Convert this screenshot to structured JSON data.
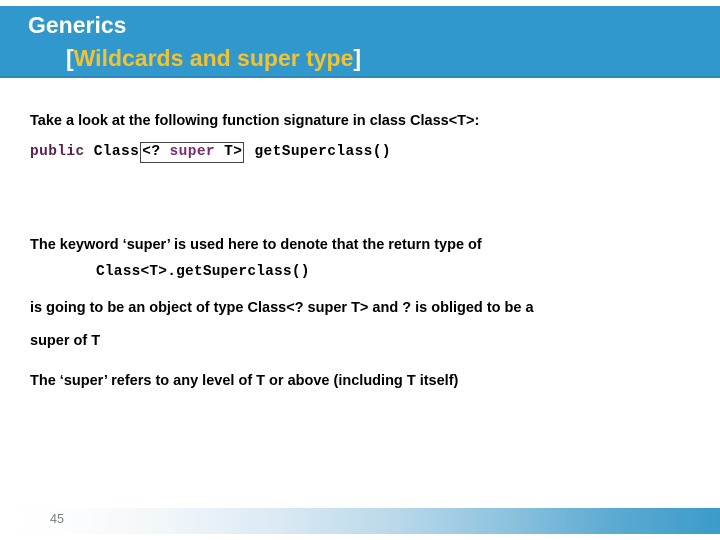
{
  "slide": {
    "banner": {
      "title": "Generics",
      "subtitle_open_bracket": "[",
      "subtitle_inner": "Wildcards and super type",
      "subtitle_close_bracket": "]",
      "background_color": "#3098cc",
      "title_color": "#ffffff",
      "subtitle_color": "#f2c230"
    },
    "body": {
      "intro_text": "Take a look at the following function signature in class Class<T>:",
      "code_signature": {
        "keyword_public": "public",
        "class_token": " Class",
        "boxed_open": "<?",
        "boxed_keyword": "super",
        "boxed_close": "T>",
        "method": " getSuperclass()",
        "keyword_color": "#5c2050",
        "box_border_color": "#444444"
      },
      "keyword_paragraph": "The keyword ‘super’ is used here to denote that the return type of",
      "code_call": "Class<T>.getSuperclass()",
      "going_line": "is going to be an object of type Class<? super T> and ? is obliged to be a",
      "super_of_t_line": "super of T",
      "refers_line": "The ‘super’ refers to any level of T or above (including T itself)"
    },
    "footer": {
      "page_number": "45",
      "gradient_from": "#ffffff",
      "gradient_to": "#3b9bc9"
    }
  }
}
